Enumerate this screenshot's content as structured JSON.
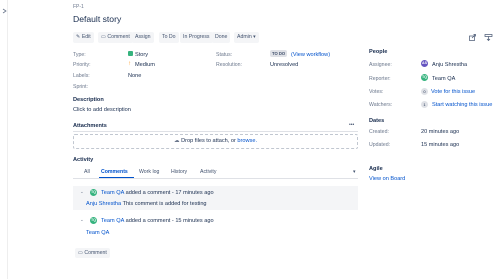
{
  "header": {
    "breadcrumb": "FP-1",
    "title": "Default story"
  },
  "toolbar": {
    "edit": "Edit",
    "comment": "Comment",
    "assign": "Assign",
    "todo": "To Do",
    "in_progress": "In Progress",
    "done": "Done",
    "admin": "Admin"
  },
  "details": {
    "type_label": "Type:",
    "type_value": "Story",
    "priority_label": "Priority:",
    "priority_value": "Medium",
    "labels_label": "Labels:",
    "labels_value": "None",
    "sprint_label": "Sprint:",
    "status_label": "Status:",
    "status_value": "TO DO",
    "view_workflow": "(View workflow)",
    "resolution_label": "Resolution:",
    "resolution_value": "Unresolved"
  },
  "description": {
    "heading": "Description",
    "placeholder": "Click to add description"
  },
  "attachments": {
    "heading": "Attachments",
    "more": "•••",
    "drop_text": "Drop files to attach, or",
    "browse": "browse."
  },
  "activity": {
    "heading": "Activity",
    "tabs": [
      "All",
      "Comments",
      "Work log",
      "History",
      "Activity"
    ],
    "comments": [
      {
        "initials": "TQ",
        "author": "Team QA",
        "meta": "added a comment - 17 minutes ago",
        "mention": "Anju Shrestha",
        "text": "This comment is added for testing"
      },
      {
        "initials": "TQ",
        "author": "Team QA",
        "meta": "added a comment - 15 minutes ago",
        "mention": "Team QA",
        "text": ""
      }
    ],
    "comment_button": "Comment"
  },
  "people": {
    "heading": "People",
    "assignee_label": "Assignee:",
    "assignee_initials": "AS",
    "assignee_value": "Anju Shrestha",
    "reporter_label": "Reporter:",
    "reporter_initials": "TQ",
    "reporter_value": "Team QA",
    "votes_label": "Votes:",
    "votes_count": "0",
    "votes_link": "Vote for this issue",
    "watchers_label": "Watchers:",
    "watchers_count": "1",
    "watchers_link": "Start watching this issue"
  },
  "dates": {
    "heading": "Dates",
    "created_label": "Created:",
    "created_value": "20 minutes ago",
    "updated_label": "Updated:",
    "updated_value": "15 minutes ago"
  },
  "agile": {
    "heading": "Agile",
    "view_on_board": "View on Board"
  },
  "colors": {
    "link": "#0052cc",
    "avatar_tq": "#36b37e",
    "avatar_as": "#6554c0",
    "story_green": "#36b37e",
    "priority_orange": "#ff991f"
  }
}
